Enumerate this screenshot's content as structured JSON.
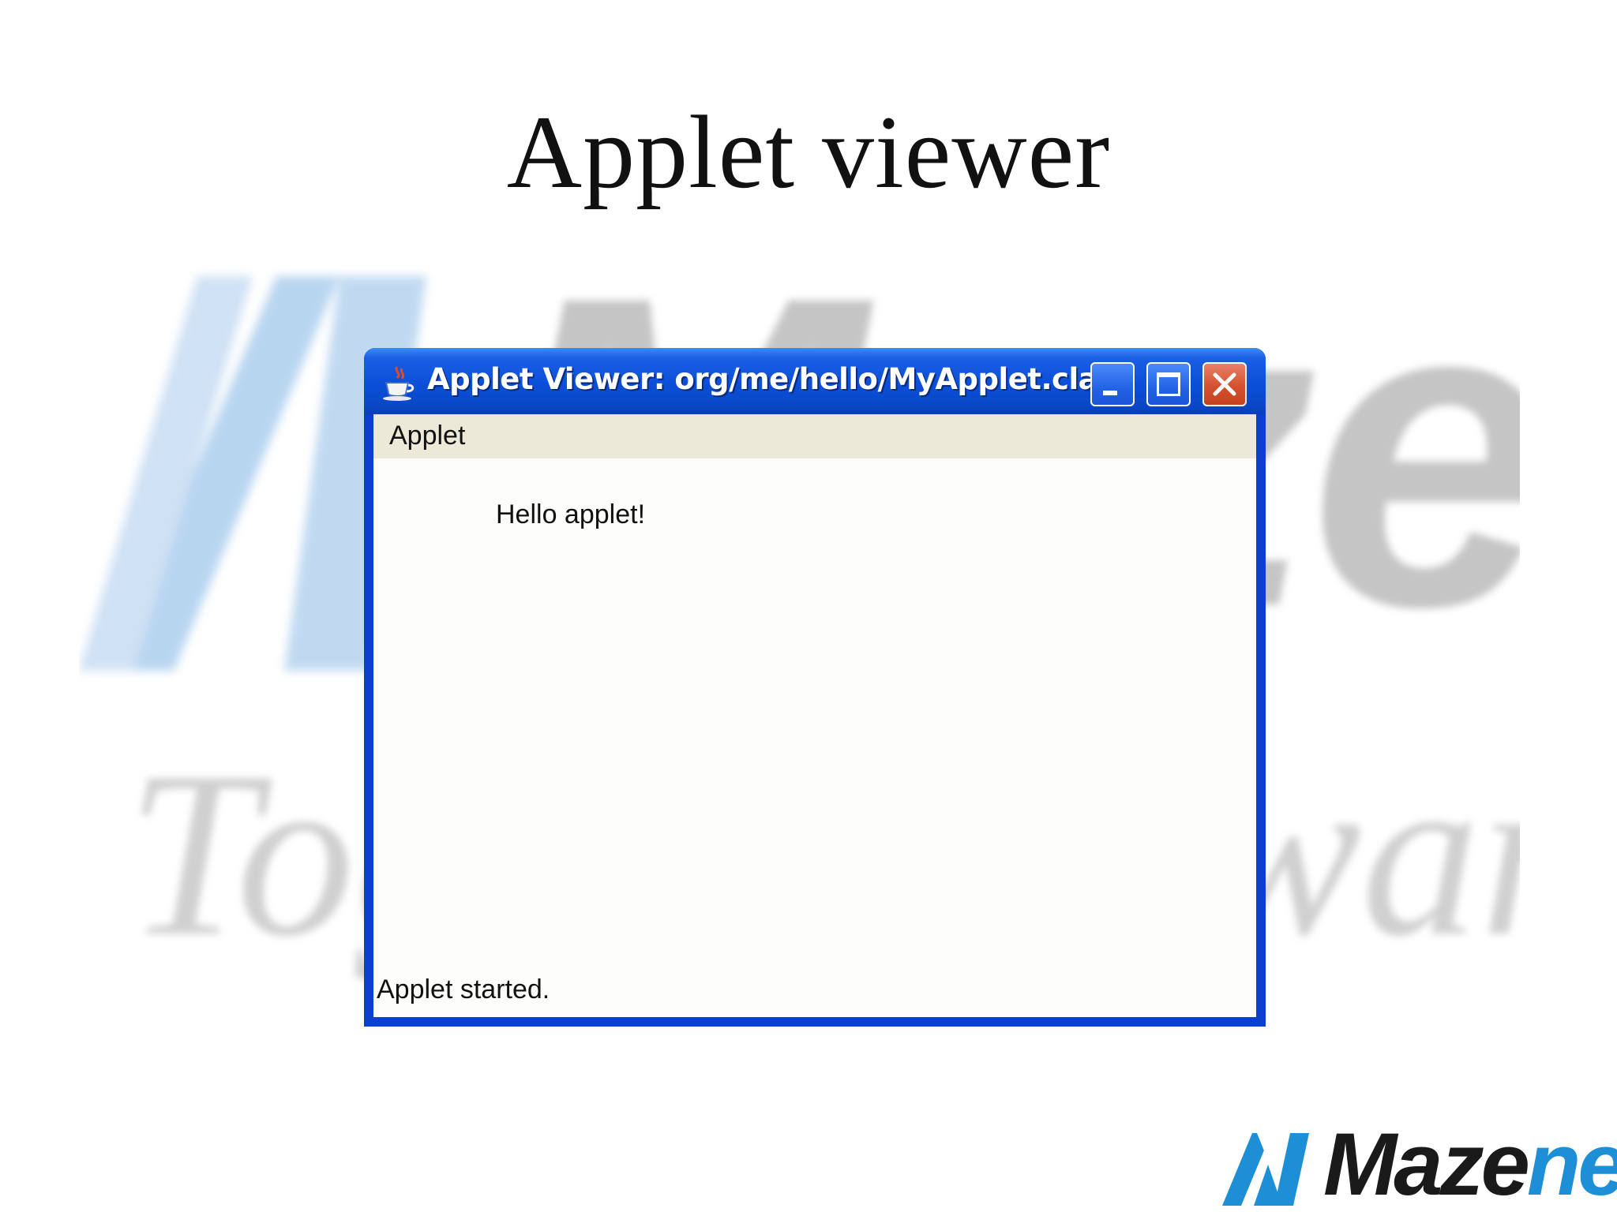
{
  "slide": {
    "title": "Applet viewer"
  },
  "watermark": {
    "brand": "Mazenet",
    "tagline": "Together towards success"
  },
  "window": {
    "title": "Applet Viewer: org/me/hello/MyApplet.class",
    "icon": "java-cup-icon",
    "menu": [
      "Applet"
    ],
    "applet_text": "Hello applet!",
    "status": "Applet started."
  },
  "brand_logo": {
    "prefix": "Maze",
    "accent": "net",
    "accent_color": "#1c8fd6"
  },
  "colors": {
    "titlebar_blue": "#0b4fd8",
    "close_red": "#d6502f",
    "menubar": "#ece9d8"
  }
}
